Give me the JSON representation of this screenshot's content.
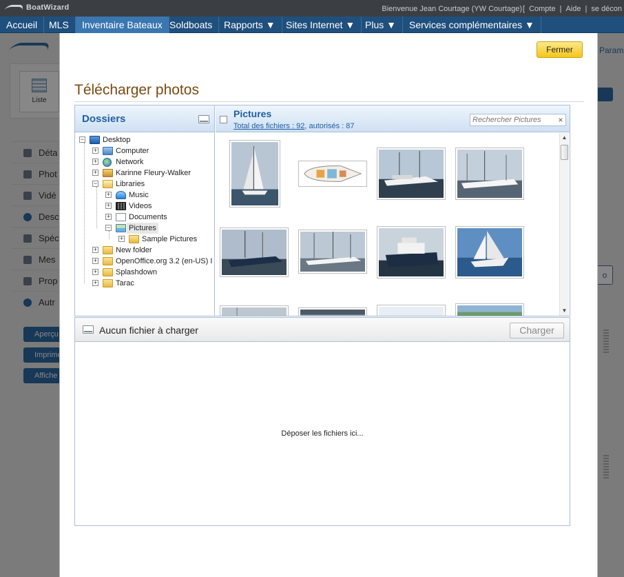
{
  "app": {
    "brand": "BoatWizard",
    "welcome": "Bienvenue Jean Courtage (YW Courtage)",
    "top_links": [
      "[",
      "Compte",
      "|",
      "Aide",
      "|",
      "se décon"
    ]
  },
  "nav": {
    "items": [
      {
        "label": "Accueil",
        "active": false
      },
      {
        "label": "MLS",
        "active": false
      },
      {
        "label": "Inventaire Bateaux",
        "active": true
      },
      {
        "label": "Soldboats",
        "active": false
      },
      {
        "label": "Rapports ▼",
        "active": false
      },
      {
        "label": "Sites Internet ▼",
        "active": false
      },
      {
        "label": "Plus ▼",
        "active": false
      },
      {
        "label": "Services complémentaires ▼",
        "active": false
      }
    ]
  },
  "background": {
    "param_text": "Param",
    "liste_label": "Liste",
    "side_items": [
      "Déta",
      "Phot",
      "Vidé",
      "Desc",
      "Spéc",
      "Mes",
      "Prop",
      "Autr"
    ],
    "actions": [
      "Aperçu",
      "Imprime",
      "Affiche"
    ],
    "right_button": "o"
  },
  "modal": {
    "close_label": "Fermer",
    "title": "Télécharger photos",
    "folders": {
      "title": "Dossiers",
      "tree": [
        {
          "label": "Desktop",
          "icon": "desktop-icon",
          "level": 0,
          "expander": "−"
        },
        {
          "label": "Computer",
          "icon": "computer-icon",
          "level": 1,
          "expander": "+"
        },
        {
          "label": "Network",
          "icon": "network-icon",
          "level": 1,
          "expander": "+"
        },
        {
          "label": "Karinne Fleury-Walker",
          "icon": "user-folder-icon",
          "level": 1,
          "expander": "+"
        },
        {
          "label": "Libraries",
          "icon": "libraries-icon",
          "level": 1,
          "expander": "−"
        },
        {
          "label": "Music",
          "icon": "music-icon",
          "level": 2,
          "expander": "+"
        },
        {
          "label": "Videos",
          "icon": "videos-icon",
          "level": 2,
          "expander": "+"
        },
        {
          "label": "Documents",
          "icon": "documents-icon",
          "level": 2,
          "expander": "+"
        },
        {
          "label": "Pictures",
          "icon": "pictures-icon",
          "level": 2,
          "expander": "−",
          "selected": true
        },
        {
          "label": "Sample Pictures",
          "icon": "folder-icon",
          "level": 3,
          "expander": "+"
        },
        {
          "label": "New folder",
          "icon": "folder-icon",
          "level": 1,
          "expander": "+"
        },
        {
          "label": "OpenOffice.org 3.2 (en-US) I",
          "icon": "folder-icon",
          "level": 1,
          "expander": "+"
        },
        {
          "label": "Splashdown",
          "icon": "folder-icon",
          "level": 1,
          "expander": "+"
        },
        {
          "label": "Tarac",
          "icon": "folder-icon",
          "level": 1,
          "expander": "+"
        }
      ]
    },
    "files": {
      "title": "Pictures",
      "total_link": "Total des fichiers : 92",
      "allowed": ", autorisés : 87",
      "search_placeholder": "Rechercher Pictures",
      "clear_label": "×"
    },
    "upload": {
      "status": "Aucun fichier à charger",
      "upload_button": "Charger",
      "drop_text": "Déposer les fichiers ici..."
    }
  },
  "thumbnail_colors": {
    "sky": "#9fb4c9",
    "sea": "#3f5b73",
    "hull": "#f2f2f2",
    "plan": "#d9e6ef"
  }
}
